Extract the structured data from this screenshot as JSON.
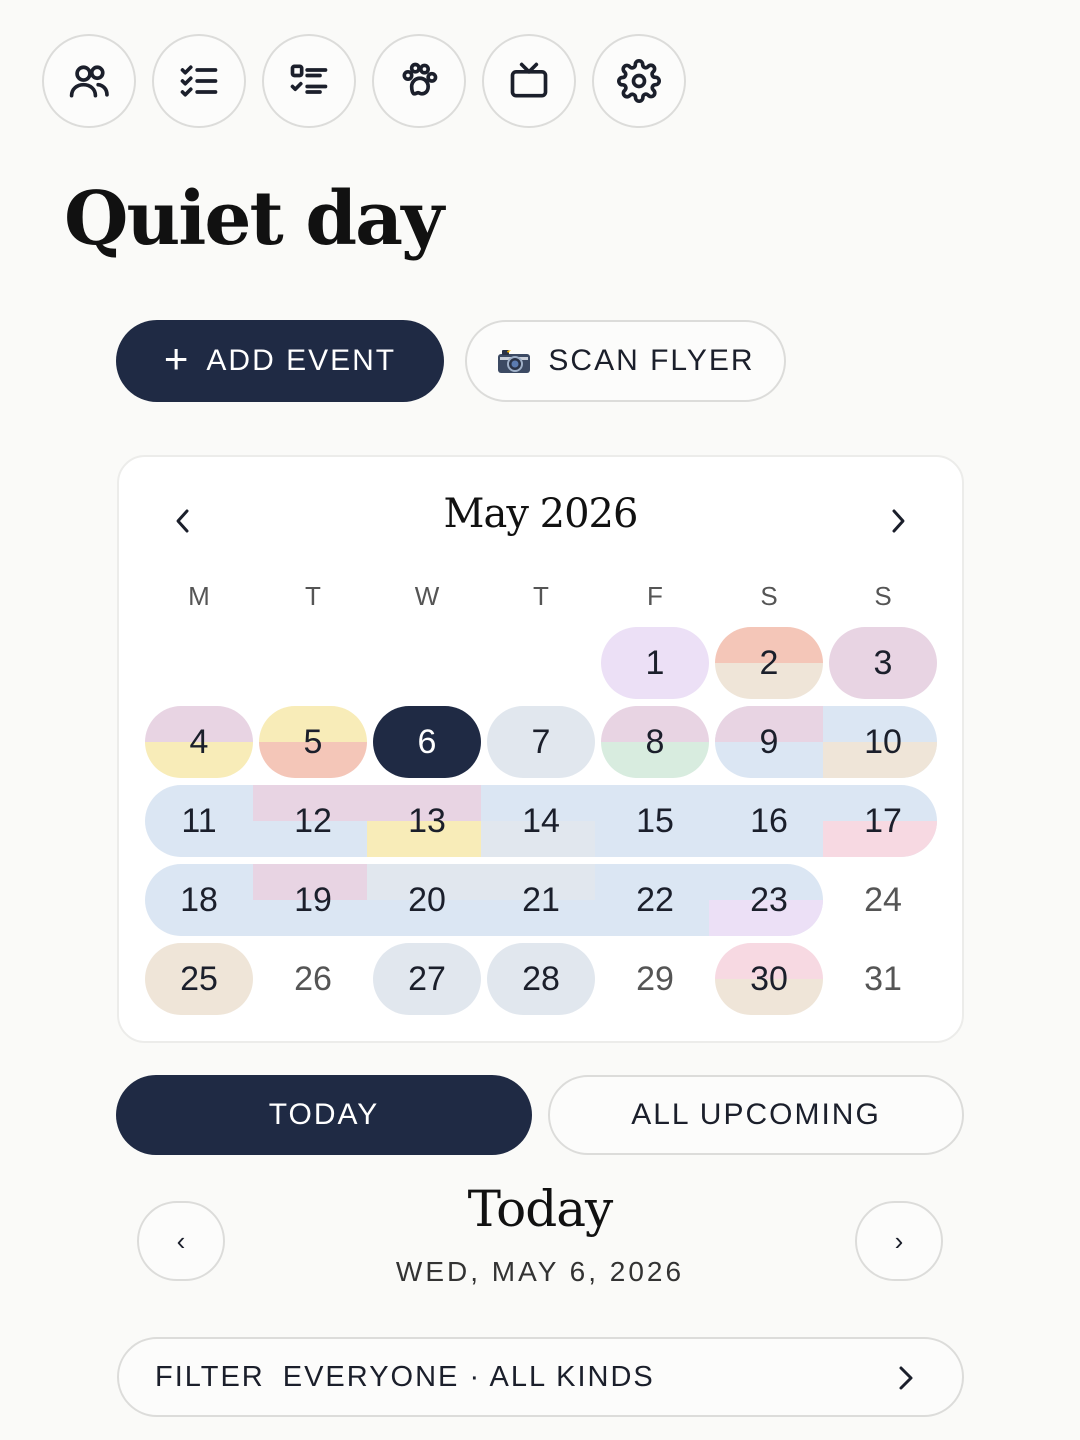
{
  "toolbar": {
    "icons": [
      "people-icon",
      "checklist-icon",
      "task-list-icon",
      "paw-icon",
      "tv-icon",
      "settings-gear-icon"
    ]
  },
  "page": {
    "title": "Quiet day"
  },
  "actions": {
    "add_event_label": "ADD EVENT",
    "scan_flyer_label": "SCAN FLYER",
    "scan_flyer_icon": "camera-flash-icon"
  },
  "calendar": {
    "month_label": "May 2026",
    "weekdays": [
      "M",
      "T",
      "W",
      "T",
      "F",
      "S",
      "S"
    ],
    "days": {
      "d1": "1",
      "d2": "2",
      "d3": "3",
      "d4": "4",
      "d5": "5",
      "d6": "6",
      "d7": "7",
      "d8": "8",
      "d9": "9",
      "d10": "10",
      "d11": "11",
      "d12": "12",
      "d13": "13",
      "d14": "14",
      "d15": "15",
      "d16": "16",
      "d17": "17",
      "d18": "18",
      "d19": "19",
      "d20": "20",
      "d21": "21",
      "d22": "22",
      "d23": "23",
      "d24": "24",
      "d25": "25",
      "d26": "26",
      "d27": "27",
      "d28": "28",
      "d29": "29",
      "d30": "30",
      "d31": "31"
    },
    "selected_day": "6",
    "event_colors": {
      "lavender": "#ece0f6",
      "salmon": "#f4c6b8",
      "sand": "#efe5d8",
      "mauve": "#e8d4e3",
      "yellow": "#f8ecb8",
      "blue": "#dbe6f3",
      "grey_blue": "#e1e7ee",
      "mint": "#d8ecdf",
      "pink": "#f7d9e2",
      "navy": "#1f2a44"
    }
  },
  "tabs": {
    "today": "TODAY",
    "all_upcoming": "ALL UPCOMING"
  },
  "day_view": {
    "title": "Today",
    "date": "WED, MAY 6, 2026",
    "prev_label": "‹",
    "next_label": "›"
  },
  "filter": {
    "label": "FILTER",
    "value": "EVERYONE · ALL KINDS"
  }
}
